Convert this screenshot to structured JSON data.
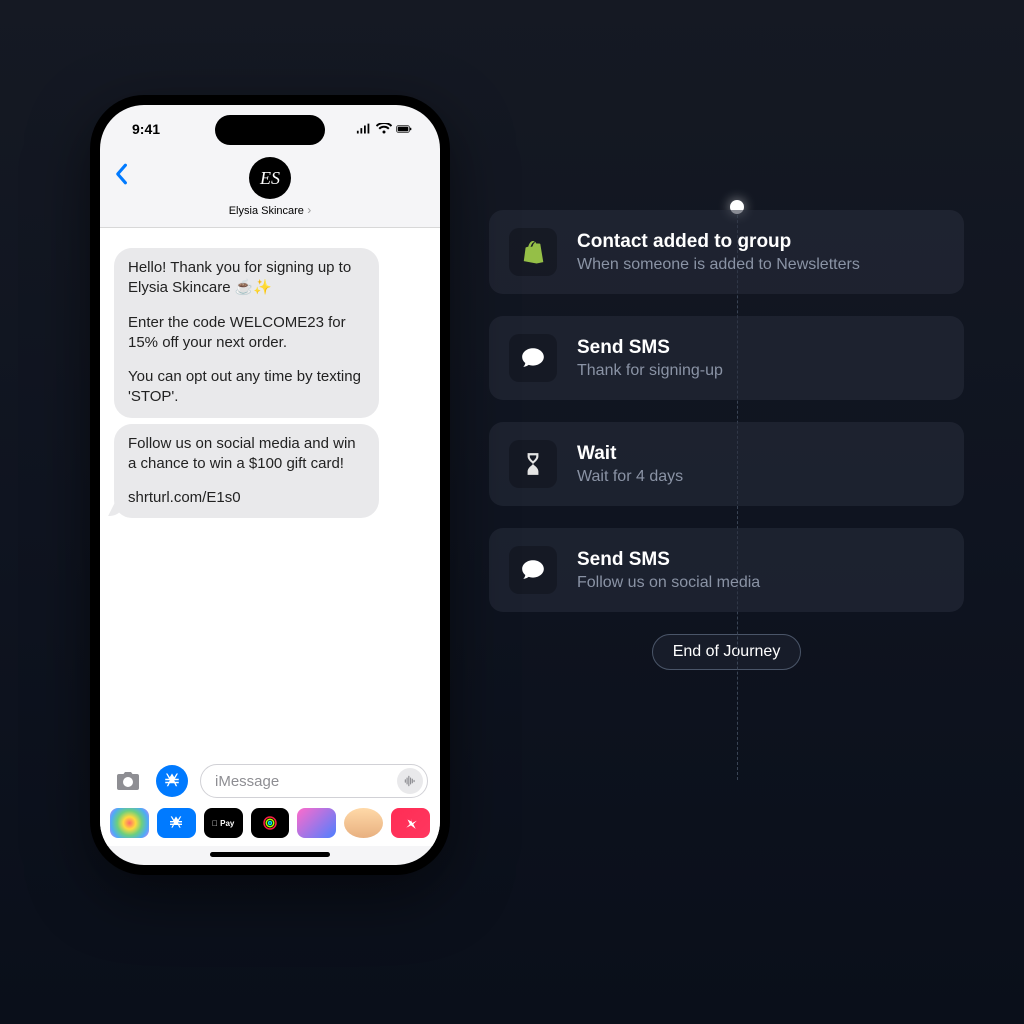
{
  "phone": {
    "status_time": "9:41",
    "contact_name": "Elysia Skincare",
    "contact_initials": "ES",
    "messages": [
      {
        "paragraphs": [
          "Hello! Thank you for signing up to Elysia Skincare ☕✨",
          "Enter the code WELCOME23 for 15% off your next order.",
          "You can opt out any time by texting 'STOP'."
        ]
      },
      {
        "paragraphs": [
          "Follow us on social media and win a chance to win a $100 gift card!",
          "shrturl.com/E1s0"
        ]
      }
    ],
    "compose_placeholder": "iMessage",
    "apple_pay_label": " Pay"
  },
  "journey": {
    "steps": [
      {
        "icon": "shopify",
        "title": "Contact added to group",
        "subtitle": "When someone is added to Newsletters"
      },
      {
        "icon": "chat",
        "title": "Send SMS",
        "subtitle": "Thank for signing-up"
      },
      {
        "icon": "hourglass",
        "title": "Wait",
        "subtitle": "Wait for 4 days"
      },
      {
        "icon": "chat",
        "title": "Send SMS",
        "subtitle": "Follow us on social media"
      }
    ],
    "end_label": "End of Journey"
  }
}
